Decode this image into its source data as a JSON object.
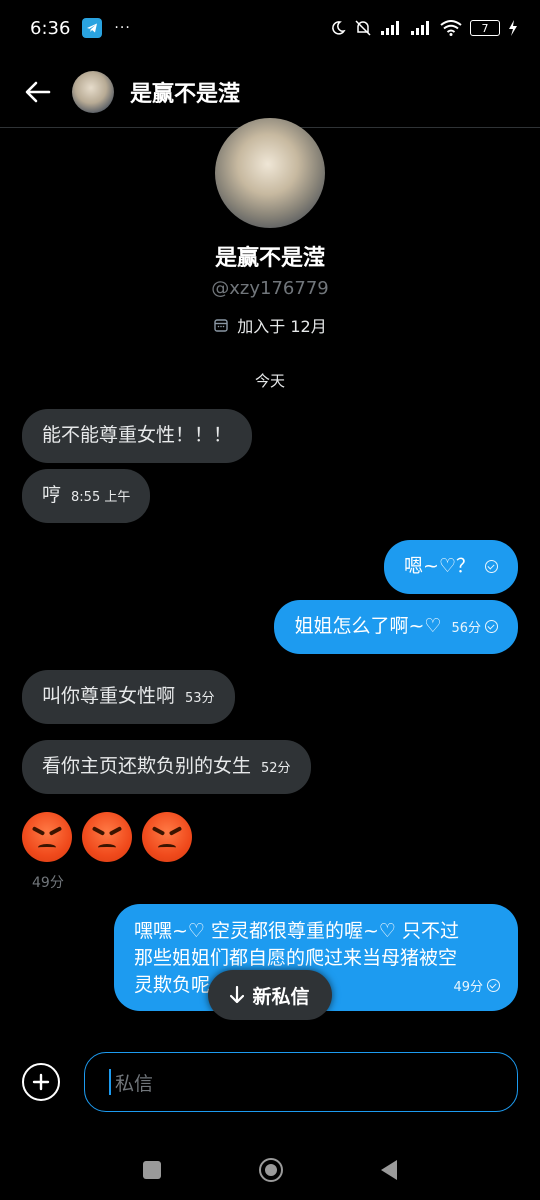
{
  "status": {
    "time": "6:36",
    "battery": "7"
  },
  "header": {
    "name": "是赢不是滢"
  },
  "profile": {
    "name": "是赢不是滢",
    "handle": "@xzy176779",
    "joined": "加入于 12月"
  },
  "day_label": "今天",
  "messages": [
    {
      "text": "能不能尊重女性！！！",
      "time": ""
    },
    {
      "text": "哼",
      "time": "8:55 上午"
    },
    {
      "text": "嗯~♡？",
      "time": ""
    },
    {
      "text": "姐姐怎么了啊~♡",
      "time": "56分"
    },
    {
      "text": "叫你尊重女性啊",
      "time": "53分"
    },
    {
      "text": "看你主页还欺负别的女生",
      "time": "52分"
    },
    {
      "text": "",
      "time": "49分"
    },
    {
      "line1": "嘿嘿~♡ 空灵都很尊重的喔~♡ 只不过",
      "line2": "那些姐姐们都自愿的爬过来当母猪被空",
      "line3": "灵欺负呢",
      "time": "49分"
    }
  ],
  "new_messages_label": "新私信",
  "composer": {
    "placeholder": "私信"
  }
}
